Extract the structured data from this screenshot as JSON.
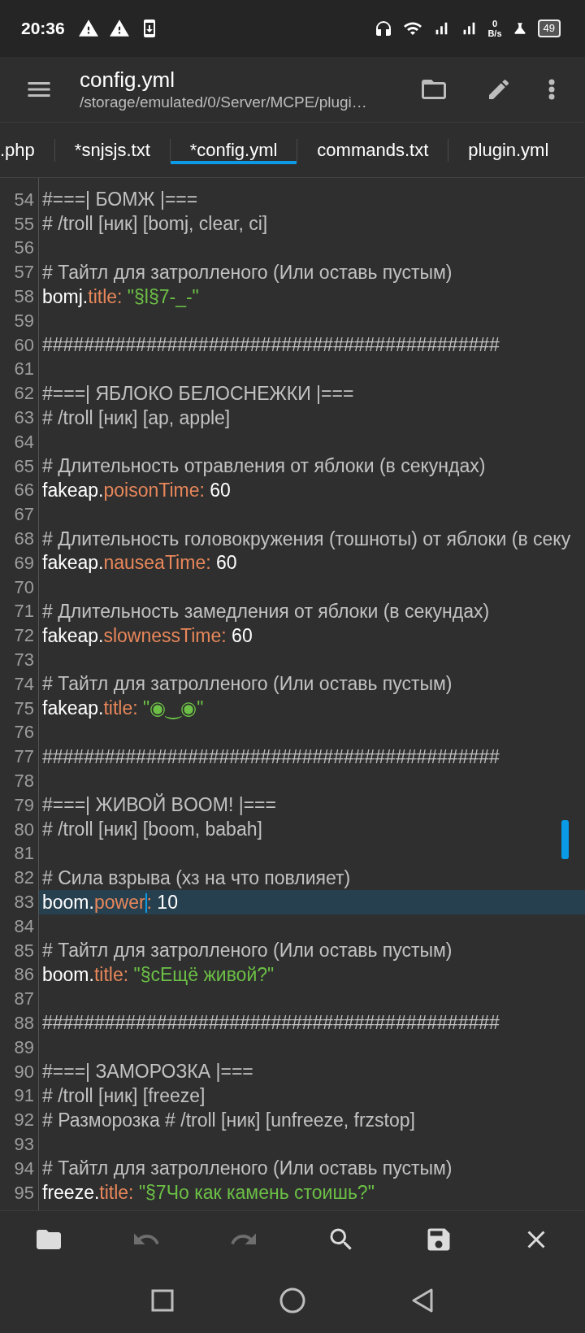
{
  "status_bar": {
    "time": "20:36",
    "net_speed": "0",
    "net_unit": "B/s",
    "battery": "49"
  },
  "toolbar": {
    "title": "config.yml",
    "path": "/storage/emulated/0/Server/MCPE/plugi…"
  },
  "tabs": [
    {
      "label": ".php",
      "selected": false
    },
    {
      "label": "*snjsjs.txt",
      "selected": false
    },
    {
      "label": "*config.yml",
      "selected": true
    },
    {
      "label": "commands.txt",
      "selected": false
    },
    {
      "label": "plugin.yml",
      "selected": false
    }
  ],
  "lines": [
    {
      "number": "54",
      "current": false,
      "segments": [
        {
          "kind": "comment",
          "text": "#===| БОМЖ |==="
        }
      ]
    },
    {
      "number": "55",
      "current": false,
      "segments": [
        {
          "kind": "comment",
          "text": "# /troll [ник] [bomj, clear, ci]"
        }
      ]
    },
    {
      "number": "56",
      "current": false
    },
    {
      "number": "57",
      "current": false,
      "segments": [
        {
          "kind": "comment",
          "text": "# Тайтл для затролленого (Или оставь пустым)"
        }
      ]
    },
    {
      "number": "58",
      "current": false,
      "segments": [
        {
          "kind": "key",
          "text": "bomj."
        },
        {
          "kind": "prop",
          "text": "title:"
        },
        {
          "kind": "string",
          "text": " \"§l§7-_-\""
        }
      ]
    },
    {
      "number": "59",
      "current": false
    },
    {
      "number": "60",
      "current": false,
      "segments": [
        {
          "kind": "comment",
          "text": "############################################"
        }
      ]
    },
    {
      "number": "61",
      "current": false
    },
    {
      "number": "62",
      "current": false,
      "segments": [
        {
          "kind": "comment",
          "text": "#===| ЯБЛОКО БЕЛОСНЕЖКИ |==="
        }
      ]
    },
    {
      "number": "63",
      "current": false,
      "segments": [
        {
          "kind": "comment",
          "text": "# /troll [ник] [ap, apple]"
        }
      ]
    },
    {
      "number": "64",
      "current": false
    },
    {
      "number": "65",
      "current": false,
      "segments": [
        {
          "kind": "comment",
          "text": "# Длительность отравления от яблоки (в секундах)"
        }
      ]
    },
    {
      "number": "66",
      "current": false,
      "segments": [
        {
          "kind": "key",
          "text": "fakeap."
        },
        {
          "kind": "prop",
          "text": "poisonTime:"
        },
        {
          "kind": "number",
          "text": " 60"
        }
      ]
    },
    {
      "number": "67",
      "current": false
    },
    {
      "number": "68",
      "current": false,
      "segments": [
        {
          "kind": "comment",
          "text": "# Длительность головокружения (тошноты) от яблоки (в секу"
        }
      ]
    },
    {
      "number": "69",
      "current": false,
      "segments": [
        {
          "kind": "key",
          "text": "fakeap."
        },
        {
          "kind": "prop",
          "text": "nauseaTime:"
        },
        {
          "kind": "number",
          "text": " 60"
        }
      ]
    },
    {
      "number": "70",
      "current": false
    },
    {
      "number": "71",
      "current": false,
      "segments": [
        {
          "kind": "comment",
          "text": "# Длительность замедления от яблоки (в секундах)"
        }
      ]
    },
    {
      "number": "72",
      "current": false,
      "segments": [
        {
          "kind": "key",
          "text": "fakeap."
        },
        {
          "kind": "prop",
          "text": "slownessTime:"
        },
        {
          "kind": "number",
          "text": " 60"
        }
      ]
    },
    {
      "number": "73",
      "current": false
    },
    {
      "number": "74",
      "current": false,
      "segments": [
        {
          "kind": "comment",
          "text": "# Тайтл для затролленого (Или оставь пустым)"
        }
      ]
    },
    {
      "number": "75",
      "current": false,
      "segments": [
        {
          "kind": "key",
          "text": "fakeap."
        },
        {
          "kind": "prop",
          "text": "title:"
        },
        {
          "kind": "string",
          "text": " \"◉‿◉\""
        }
      ]
    },
    {
      "number": "76",
      "current": false
    },
    {
      "number": "77",
      "current": false,
      "segments": [
        {
          "kind": "comment",
          "text": "############################################"
        }
      ]
    },
    {
      "number": "78",
      "current": false
    },
    {
      "number": "79",
      "current": false,
      "segments": [
        {
          "kind": "comment",
          "text": "#===| ЖИВОЙ BOOM! |==="
        }
      ]
    },
    {
      "number": "80",
      "current": false,
      "segments": [
        {
          "kind": "comment",
          "text": "# /troll [ник] [boom, babah]"
        }
      ]
    },
    {
      "number": "81",
      "current": false
    },
    {
      "number": "82",
      "current": false,
      "segments": [
        {
          "kind": "comment",
          "text": "# Сила взрыва (хз на что повлияет)"
        }
      ]
    },
    {
      "number": "83",
      "current": true,
      "segments": [
        {
          "kind": "key",
          "text": "boom."
        },
        {
          "kind": "prop",
          "text": "power"
        },
        {
          "kind": "cursor"
        },
        {
          "kind": "prop",
          "text": ":"
        },
        {
          "kind": "number",
          "text": " 10"
        }
      ]
    },
    {
      "number": "84",
      "current": false
    },
    {
      "number": "85",
      "current": false,
      "segments": [
        {
          "kind": "comment",
          "text": "# Тайтл для затролленого (Или оставь пустым)"
        }
      ]
    },
    {
      "number": "86",
      "current": false,
      "segments": [
        {
          "kind": "key",
          "text": "boom."
        },
        {
          "kind": "prop",
          "text": "title:"
        },
        {
          "kind": "string",
          "text": " \"§cЕщё живой?\""
        }
      ]
    },
    {
      "number": "87",
      "current": false
    },
    {
      "number": "88",
      "current": false,
      "segments": [
        {
          "kind": "comment",
          "text": "############################################"
        }
      ]
    },
    {
      "number": "89",
      "current": false
    },
    {
      "number": "90",
      "current": false,
      "segments": [
        {
          "kind": "comment",
          "text": "#===| ЗАМОРОЗКА |==="
        }
      ]
    },
    {
      "number": "91",
      "current": false,
      "segments": [
        {
          "kind": "comment",
          "text": "# /troll [ник] [freeze]"
        }
      ]
    },
    {
      "number": "92",
      "current": false,
      "segments": [
        {
          "kind": "comment",
          "text": "# Разморозка # /troll [ник] [unfreeze, frzstop]"
        }
      ]
    },
    {
      "number": "93",
      "current": false
    },
    {
      "number": "94",
      "current": false,
      "segments": [
        {
          "kind": "comment",
          "text": "# Тайтл для затролленого (Или оставь пустым)"
        }
      ]
    },
    {
      "number": "95",
      "current": false,
      "segments": [
        {
          "kind": "key",
          "text": "freeze."
        },
        {
          "kind": "prop",
          "text": "title:"
        },
        {
          "kind": "string",
          "text": " \"§7Чо как камень стоишь?\""
        }
      ]
    }
  ],
  "bottom_bar": [
    {
      "kind": "open",
      "disabled": false
    },
    {
      "kind": "undo",
      "disabled": true
    },
    {
      "kind": "redo",
      "disabled": true
    },
    {
      "kind": "search",
      "disabled": false
    },
    {
      "kind": "save",
      "disabled": false
    },
    {
      "kind": "close",
      "disabled": false
    }
  ]
}
